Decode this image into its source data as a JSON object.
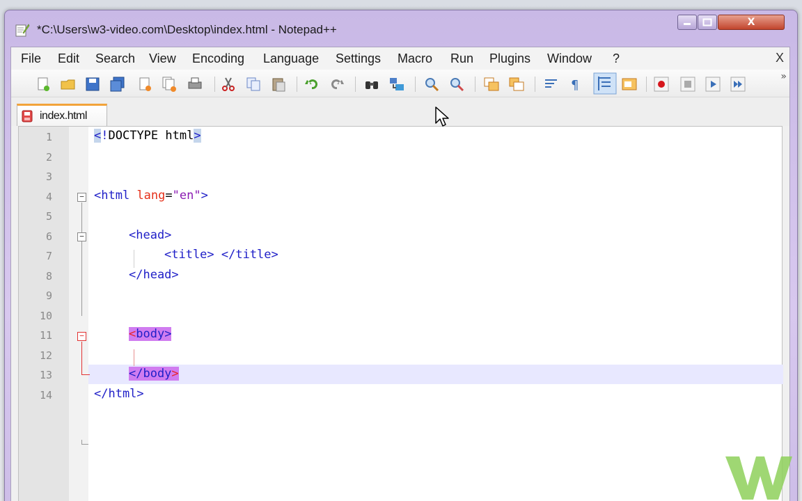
{
  "window": {
    "title": "*C:\\Users\\w3-video.com\\Desktop\\index.html - Notepad++",
    "minimize_label": "▭",
    "maximize_label": "❐",
    "close_label": "X"
  },
  "menu": {
    "items": [
      "File",
      "Edit",
      "Search",
      "View",
      "Encoding",
      "Language",
      "Settings",
      "Macro",
      "Run",
      "Plugins",
      "Window",
      "?"
    ],
    "close_label": "X"
  },
  "toolbar": {
    "icons": [
      "new-file-icon",
      "open-file-icon",
      "save-icon",
      "save-all-icon",
      "close-icon",
      "close-all-icon",
      "print-icon",
      "cut-icon",
      "copy-icon",
      "paste-icon",
      "undo-icon",
      "redo-icon",
      "find-icon",
      "replace-icon",
      "zoom-in-icon",
      "zoom-out-icon",
      "sync-vertical-icon",
      "sync-horizontal-icon",
      "word-wrap-icon",
      "show-all-chars-icon",
      "indent-guide-icon",
      "user-lang-icon",
      "record-macro-icon",
      "stop-record-icon",
      "play-macro-icon",
      "run-macro-multiple-icon"
    ],
    "more_label": "»"
  },
  "tabs": [
    {
      "label": "index.html",
      "active": true,
      "unsaved": true
    }
  ],
  "editor": {
    "current_line": 13,
    "lines": [
      {
        "n": "1"
      },
      {
        "n": "2"
      },
      {
        "n": "3"
      },
      {
        "n": "4"
      },
      {
        "n": "5"
      },
      {
        "n": "6"
      },
      {
        "n": "7"
      },
      {
        "n": "8"
      },
      {
        "n": "9"
      },
      {
        "n": "10"
      },
      {
        "n": "11"
      },
      {
        "n": "12"
      },
      {
        "n": "13"
      },
      {
        "n": "14"
      }
    ],
    "code": {
      "l1_open": "<",
      "l1_bang": "!",
      "l1_rest": "DOCTYPE html",
      "l1_close": ">",
      "l4_tag": "<html",
      "l4_attr": "lang",
      "l4_eq": "=",
      "l4_val": "\"en\"",
      "l4_close": ">",
      "l6": "<head>",
      "l7": "<title> </title>",
      "l8": "</head>",
      "l11_lt": "<",
      "l11_rest": "body>",
      "l13_rest": "</body",
      "l13_gt": ">",
      "l14": "</html>"
    }
  },
  "colors": {
    "tag": "#2020c8",
    "attribute": "#e5301a",
    "value": "#8a1ab2",
    "brace_match": "#d07cf0",
    "current_line": "#e8e8ff",
    "titlebar": "#cdbde8"
  }
}
